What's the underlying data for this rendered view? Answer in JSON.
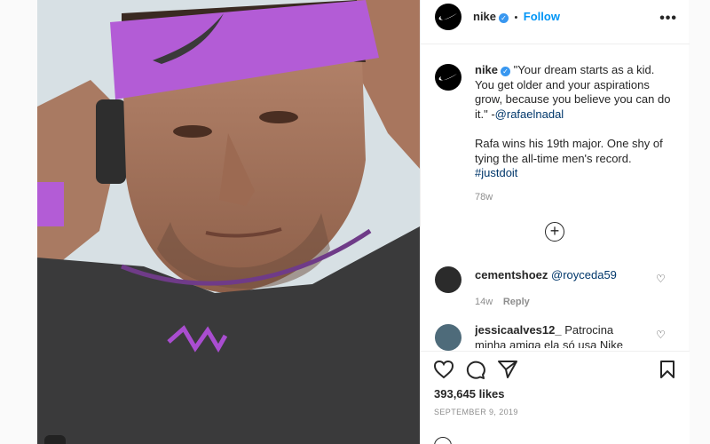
{
  "post": {
    "image_alt": "Rafael Nadal wearing purple Nike headband",
    "header": {
      "username": "nike",
      "separator": "•",
      "follow_label": "Follow"
    },
    "caption": {
      "username": "nike",
      "quote": "\"Your dream starts as a kid. You get older and your aspirations grow, because you believe you can do it.\" -",
      "mention": "@rafaelnadal",
      "body": "Rafa wins his 19th major. One shy of tying the all-time men's record.",
      "hashtag": "#justdoit",
      "age": "78w"
    },
    "comments": [
      {
        "username": "cementshoez",
        "mention": "@royceda59",
        "age": "14w",
        "reply_label": "Reply"
      },
      {
        "username": "jessicaalves12_",
        "text": "Patrocina minha amiga ela só usa Nike"
      }
    ],
    "likes": "393,645 likes",
    "date": "SEPTEMBER 9, 2019"
  },
  "colors": {
    "accent": "#0095f6",
    "verified": "#3897f0",
    "headband": "#b35cd6",
    "link": "#00376b",
    "muted": "#8e8e8e"
  }
}
